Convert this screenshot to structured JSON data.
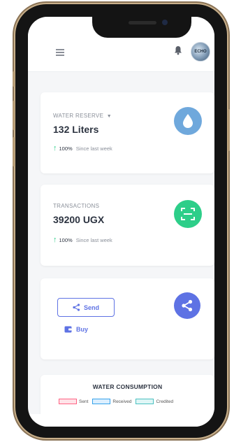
{
  "header": {
    "menu_icon": "hamburger-icon",
    "notification_icon": "bell-icon",
    "avatar_text": "ЕСНО"
  },
  "cards": {
    "water_reserve": {
      "label": "WATER RESERVE",
      "value": "132 Liters",
      "trend_percent": "100%",
      "trend_text": "Since last week",
      "icon": "water-drop-icon",
      "icon_color": "#6fa8dc"
    },
    "transactions": {
      "label": "TRANSACTIONS",
      "value": "39200 UGX",
      "trend_percent": "100%",
      "trend_text": "Since last week",
      "icon": "scan-icon",
      "icon_color": "#2dce89"
    },
    "actions": {
      "send_label": "Send",
      "buy_label": "Buy",
      "icon": "share-icon",
      "icon_color": "#5e72e4"
    },
    "water_consumption": {
      "title": "WATER CONSUMPTION",
      "legend": [
        "Sent",
        "Received",
        "Credited"
      ]
    }
  },
  "colors": {
    "accent": "#5e72e4",
    "success": "#2dce89",
    "water": "#6fa8dc"
  }
}
